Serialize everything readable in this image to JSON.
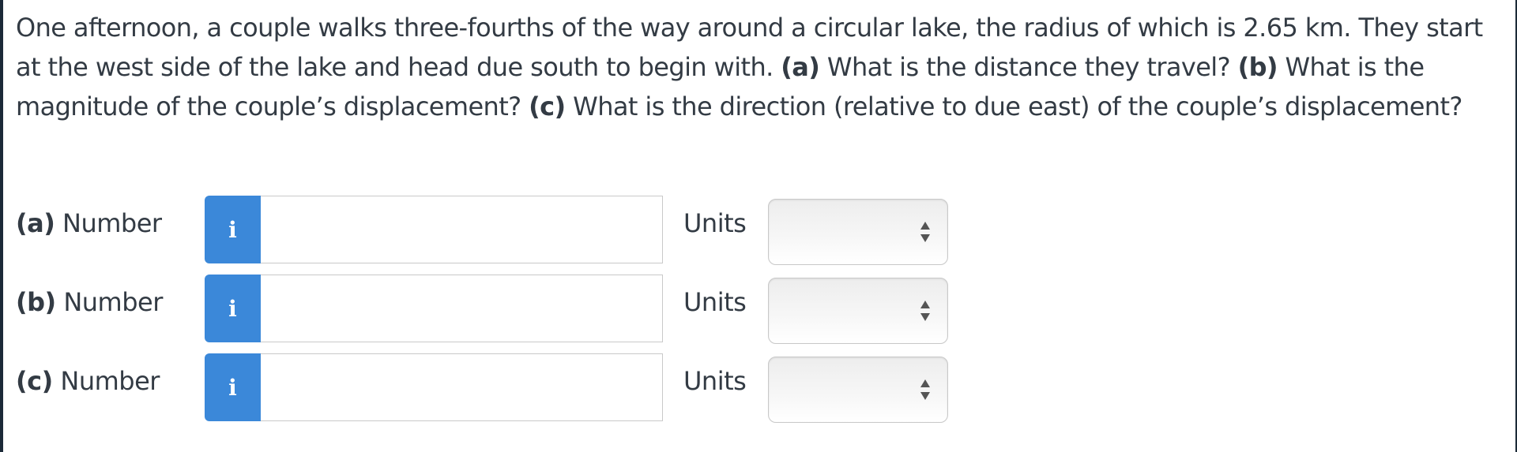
{
  "question": {
    "intro": "One afternoon, a couple walks three-fourths of the way around a circular lake, the radius of which is 2.65 km. They start at the west side of the lake and head due south to begin with.",
    "part_a_label": "(a)",
    "part_a_text": "What is the distance they travel?",
    "part_b_label": "(b)",
    "part_b_text": "What is the magnitude of the couple’s displacement?",
    "part_c_label": "(c)",
    "part_c_text": "What is the direction (relative to due east) of the couple’s displacement?"
  },
  "answers": [
    {
      "part": "(a)",
      "label": "Number",
      "info_glyph": "i",
      "value": "",
      "units_label": "Units",
      "units_value": ""
    },
    {
      "part": "(b)",
      "label": "Number",
      "info_glyph": "i",
      "value": "",
      "units_label": "Units",
      "units_value": ""
    },
    {
      "part": "(c)",
      "label": "Number",
      "info_glyph": "i",
      "value": "",
      "units_label": "Units",
      "units_value": ""
    }
  ],
  "colors": {
    "accent": "#3b88d9",
    "text": "#333b44",
    "frame": "#1c2a38"
  }
}
